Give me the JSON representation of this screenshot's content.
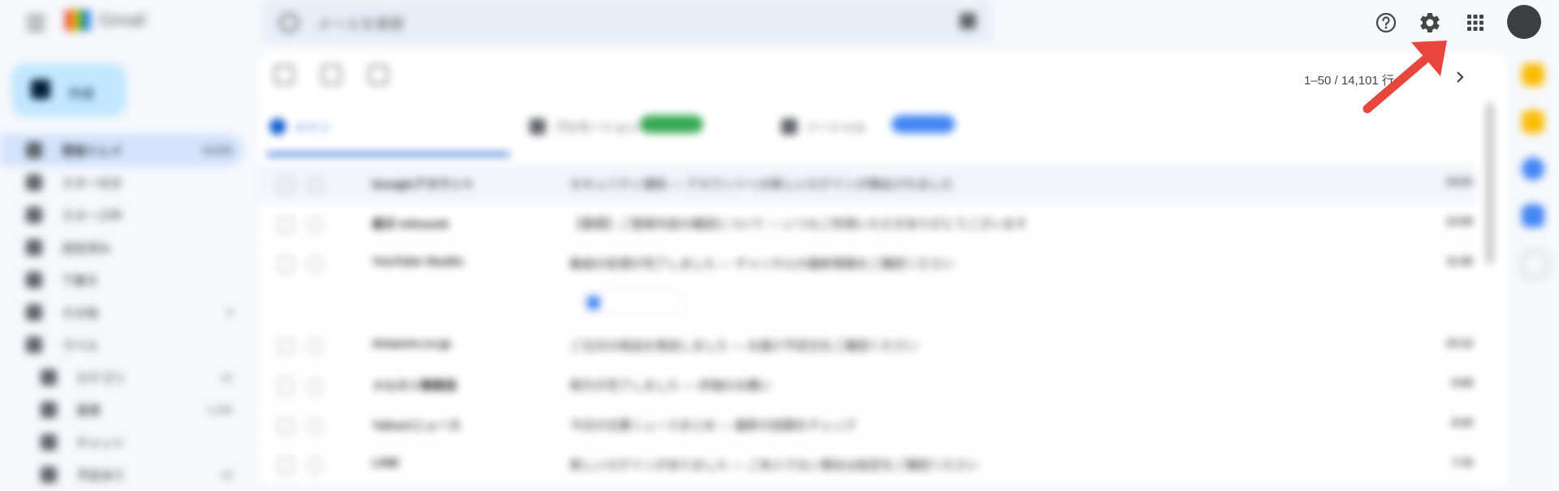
{
  "app": {
    "logo_text": "Gmail"
  },
  "search": {
    "placeholder": "メールを検索"
  },
  "compose": {
    "label": "作成"
  },
  "sidebar": {
    "items": [
      {
        "label": "受信トレイ",
        "count": "14,101"
      },
      {
        "label": "スター付き",
        "count": ""
      },
      {
        "label": "スヌーズ中",
        "count": ""
      },
      {
        "label": "送信済み",
        "count": ""
      },
      {
        "label": "下書き",
        "count": ""
      },
      {
        "label": "その他",
        "count": "3"
      },
      {
        "label": "ラベル",
        "count": ""
      },
      {
        "label": "カテゴリ",
        "count": "12"
      },
      {
        "label": "重要",
        "count": "1,234"
      },
      {
        "label": "チャット",
        "count": ""
      },
      {
        "label": "予定あり",
        "count": "12"
      }
    ]
  },
  "tabs": [
    {
      "label": "メイン",
      "sub": ""
    },
    {
      "label": "プロモーション",
      "sub": "新着"
    },
    {
      "label": "ソーシャル",
      "sub": "新着"
    }
  ],
  "pagination": {
    "text": "1–50 / 14,101 行"
  },
  "emails": [
    {
      "sender": "Googleアカウント",
      "subject": "セキュリティ通知 — アカウントへの新しいログインが検出されました",
      "date": "14:21"
    },
    {
      "sender": "楽天 Infoseek",
      "subject": "【重要】ご登録内容の確認について — いつもご利用いただきありがとうございます",
      "date": "13:05"
    },
    {
      "sender": "YouTube Studio",
      "subject": "動画の処理が完了しました — チャンネルの最新情報をご確認ください",
      "date": "11:40"
    },
    {
      "sender": "Amazon.co.jp",
      "subject": "ご注文の商品を発送しました — お届け予定日をご確認ください",
      "date": "10:12"
    },
    {
      "sender": "メルカリ事務局",
      "subject": "取引が完了しました — 評価のお願い",
      "date": "9:58"
    },
    {
      "sender": "Yahoo!ニュース",
      "subject": "今日の主要ニュースまとめ — 最新の話題をチェック",
      "date": "8:30"
    },
    {
      "sender": "LINE",
      "subject": "新しいログインがありました — ご本人でない場合は設定をご確認ください",
      "date": "7:15"
    }
  ],
  "icons": {
    "support": "help-circle-icon",
    "settings": "gear-icon",
    "apps": "apps-grid-icon",
    "next": "chevron-right-icon"
  },
  "annotation": {
    "arrow_color": "#e8453c"
  },
  "colors": {
    "accent": "#0b57d0",
    "background": "#f6f8fc"
  }
}
